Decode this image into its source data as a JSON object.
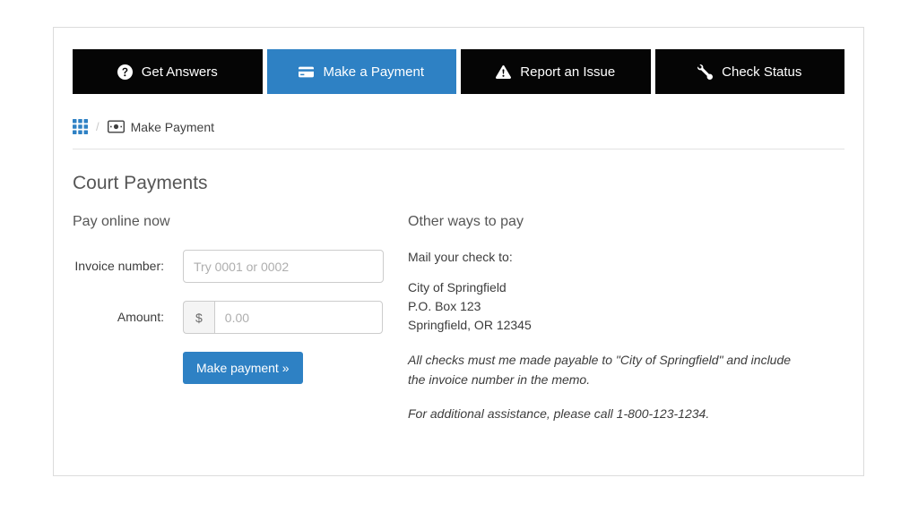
{
  "colors": {
    "accent": "#2e81c4",
    "tab_bg": "#050505"
  },
  "tabs": [
    {
      "label": "Get Answers",
      "icon": "question-circle-icon",
      "active": false
    },
    {
      "label": "Make a Payment",
      "icon": "credit-card-icon",
      "active": true
    },
    {
      "label": "Report an Issue",
      "icon": "warning-triangle-icon",
      "active": false
    },
    {
      "label": "Check Status",
      "icon": "wrench-icon",
      "active": false
    }
  ],
  "breadcrumb": {
    "separator": "/",
    "current": "Make Payment"
  },
  "page": {
    "title": "Court Payments"
  },
  "pay_online": {
    "heading": "Pay online now",
    "invoice_label": "Invoice number:",
    "invoice_placeholder": "Try 0001 or 0002",
    "invoice_value": "",
    "amount_label": "Amount:",
    "currency_symbol": "$",
    "amount_placeholder": "0.00",
    "amount_value": "",
    "submit_label": "Make payment »"
  },
  "other_ways": {
    "heading": "Other ways to pay",
    "mail_intro": "Mail your check to:",
    "address_lines": [
      "City of Springfield",
      "P.O. Box 123",
      "Springfield, OR 12345"
    ],
    "note1": "All checks must me made payable to \"City of Springfield\" and include the invoice number in the memo.",
    "note2": "For additional assistance, please call 1-800-123-1234."
  }
}
